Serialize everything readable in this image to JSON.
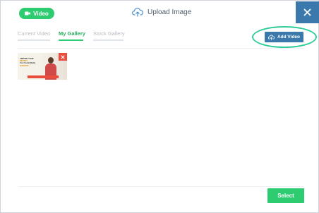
{
  "header": {
    "video_label": "Video",
    "upload_label": "Upload Image"
  },
  "tabs": [
    {
      "label": "Current Video",
      "active": false
    },
    {
      "label": "My Gallery",
      "active": true
    },
    {
      "label": "Stock Gallery",
      "active": false
    }
  ],
  "toolbar": {
    "add_video_label": "Add Video"
  },
  "gallery": {
    "items": [
      {
        "headline_lines": [
          "LIMITING YOUR",
          "BELIEFS",
          "Your Social Media",
          "SUCCESS"
        ]
      }
    ]
  },
  "footer": {
    "select_label": "Select"
  },
  "colors": {
    "green": "#2ecc71",
    "blue": "#3b79ad",
    "red": "#e74c3c",
    "highlight": "#2ecc9a"
  },
  "icons": {
    "video": "video-camera-icon",
    "upload": "cloud-upload-icon",
    "close": "close-icon",
    "add_video": "cloud-upload-icon",
    "remove_item": "close-icon"
  }
}
